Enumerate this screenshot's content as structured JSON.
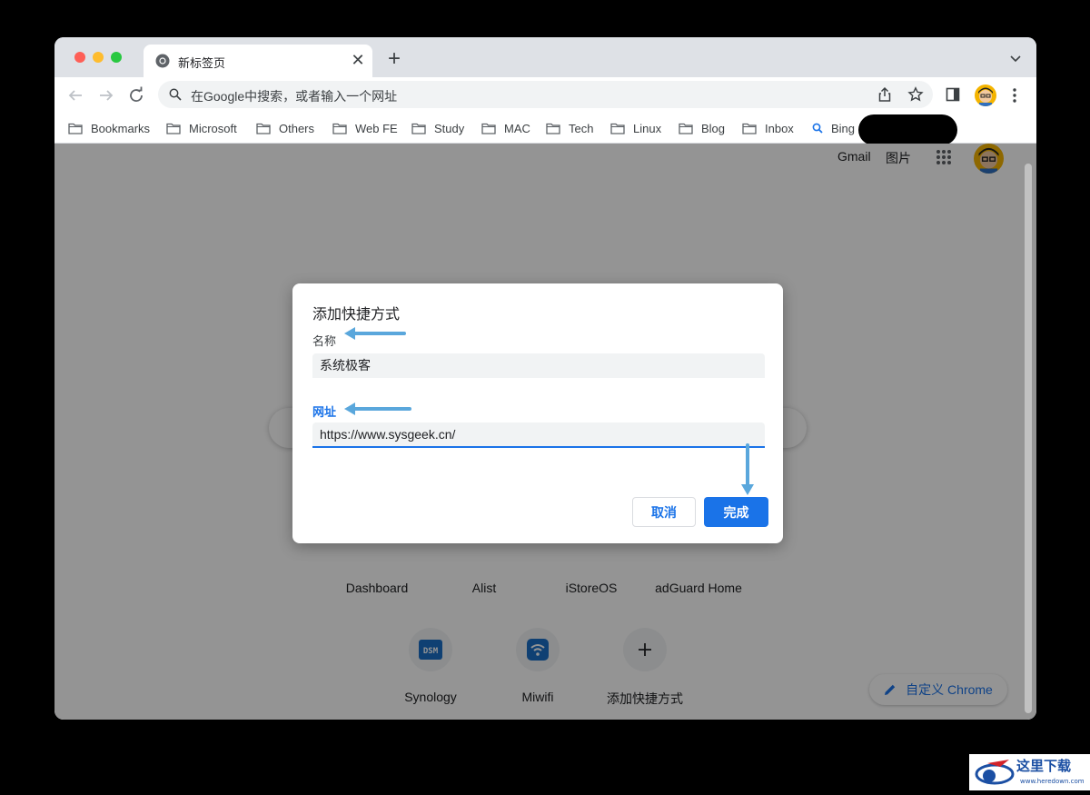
{
  "tab": {
    "title": "新标签页"
  },
  "omnibox": {
    "placeholder": "在Google中搜索，或者输入一个网址"
  },
  "bookmarks": [
    "Bookmarks",
    "Microsoft",
    "Others",
    "Web FE",
    "Study",
    "MAC",
    "Tech",
    "Linux",
    "Blog",
    "Inbox",
    "Bing"
  ],
  "top_links": {
    "gmail": "Gmail",
    "images": "图片"
  },
  "shortcuts": {
    "row1": [
      "Dashboard",
      "Alist",
      "iStoreOS",
      "adGuard Home"
    ],
    "row2": [
      {
        "label": "Synology",
        "icon": "dsm-icon"
      },
      {
        "label": "Miwifi",
        "icon": "wifi-icon"
      },
      {
        "label": "添加快捷方式",
        "icon": "plus-icon"
      }
    ]
  },
  "customize": {
    "label": "自定义 Chrome"
  },
  "dialog": {
    "title": "添加快捷方式",
    "name_label": "名称",
    "name_value": "系统极客",
    "url_label": "网址",
    "url_value": "https://www.sysgeek.cn/",
    "cancel": "取消",
    "done": "完成"
  },
  "colors": {
    "accent": "#1a73e8",
    "annotation_arrow": "#5aa7dc"
  }
}
